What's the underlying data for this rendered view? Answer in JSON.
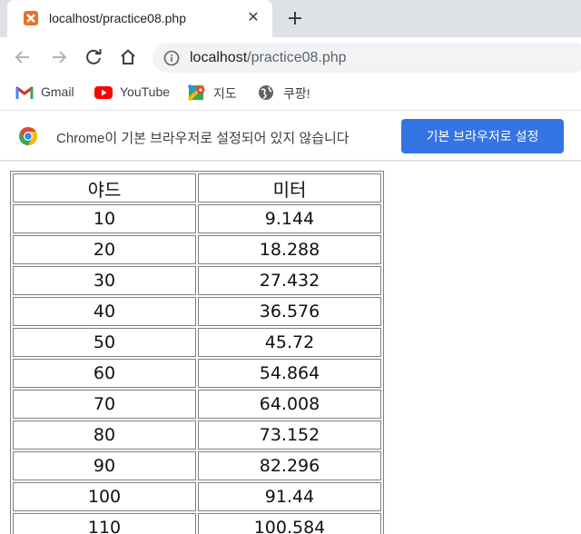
{
  "browser": {
    "tab": {
      "title": "localhost/practice08.php",
      "favicon": "xampp-icon",
      "close_glyph": "✕"
    },
    "address_bar": {
      "host": "localhost",
      "path": "/practice08.php"
    },
    "bookmarks": [
      {
        "label": "Gmail",
        "icon": "gmail-icon"
      },
      {
        "label": "YouTube",
        "icon": "youtube-icon"
      },
      {
        "label": "지도",
        "icon": "maps-icon"
      },
      {
        "label": "쿠팡!",
        "icon": "globe-icon"
      }
    ],
    "infobar": {
      "message": "Chrome이 기본 브라우저로 설정되어 있지 않습니다",
      "button_label": "기본 브라우저로 설정"
    }
  },
  "page": {
    "table": {
      "headers": [
        "야드",
        "미터"
      ],
      "rows": [
        [
          "10",
          "9.144"
        ],
        [
          "20",
          "18.288"
        ],
        [
          "30",
          "27.432"
        ],
        [
          "40",
          "36.576"
        ],
        [
          "50",
          "45.72"
        ],
        [
          "60",
          "54.864"
        ],
        [
          "70",
          "64.008"
        ],
        [
          "80",
          "73.152"
        ],
        [
          "90",
          "82.296"
        ],
        [
          "100",
          "91.44"
        ],
        [
          "110",
          "100.584"
        ]
      ]
    }
  }
}
